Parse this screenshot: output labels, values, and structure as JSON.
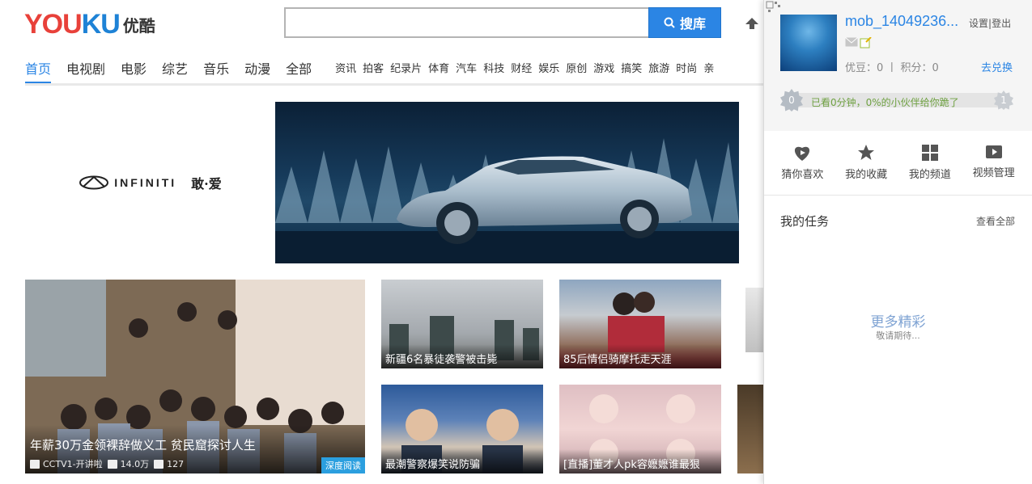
{
  "header": {
    "logo_en": "YOUKU",
    "logo_cn": "优酷",
    "search_placeholder": "",
    "search_button": "搜库"
  },
  "nav": {
    "main": [
      "首页",
      "电视剧",
      "电影",
      "综艺",
      "音乐",
      "动漫",
      "全部"
    ],
    "sub": [
      "资讯",
      "拍客",
      "纪录片",
      "体育",
      "汽车",
      "科技",
      "财经",
      "娱乐",
      "原创",
      "游戏",
      "搞笑",
      "旅游",
      "时尚",
      "亲"
    ]
  },
  "banner": {
    "brand": "INFINITI",
    "brand_cn": "敢·爱"
  },
  "feature": {
    "title": "年薪30万金领裸辞做义工 贫民窟探讨人生",
    "channel": "CCTV1-开讲啦",
    "views": "14.0万",
    "comments": "127",
    "tag": "深度阅读"
  },
  "thumbs": [
    {
      "title": "新疆6名暴徒袭警被击毙"
    },
    {
      "title": "85后情侣骑摩托走天涯"
    },
    {
      "title": "最潮警察爆笑说防骗"
    },
    {
      "title": "[直播]董才人pk容嬷嬷谁最狠"
    }
  ],
  "panel": {
    "username": "mob_14049236...",
    "settings": "设置",
    "sep": "|",
    "logout": "登出",
    "points": "优豆：0 丨 积分：0",
    "redeem": "去兑换",
    "progress_text": "已看0分钟，0%的小伙伴给你跪了",
    "level_current": "0",
    "level_next": "1",
    "quick": [
      "猜你喜欢",
      "我的收藏",
      "我的频道",
      "视频管理"
    ],
    "task_title": "我的任务",
    "task_all": "查看全部",
    "more_title": "更多精彩",
    "more_sub": "敬请期待..."
  },
  "colors": {
    "accent": "#2b85e4",
    "logo_red": "#e8413a",
    "progress_text": "#6fa142"
  }
}
